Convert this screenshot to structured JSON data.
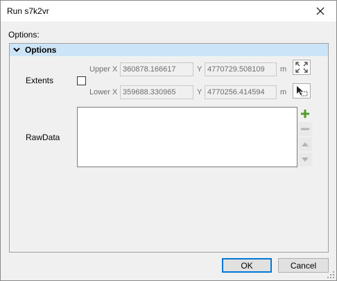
{
  "window": {
    "title": "Run s7k2vr"
  },
  "options_label": "Options:",
  "section": {
    "title": "Options"
  },
  "extents": {
    "label": "Extents",
    "checked": false,
    "upper_x_label": "Upper X",
    "upper_x_value": "360878.166617",
    "upper_y_label": "Y",
    "upper_y_value": "4770729.508109",
    "upper_unit": "m",
    "lower_x_label": "Lower X",
    "lower_x_value": "359688.330965",
    "lower_y_label": "Y",
    "lower_y_value": "4770256.414594",
    "lower_unit": "m"
  },
  "rawdata": {
    "label": "RawData",
    "items": []
  },
  "buttons": {
    "ok": "OK",
    "cancel": "Cancel"
  },
  "colors": {
    "accent": "#0078d7",
    "section_bg": "#cce4f7",
    "add_green": "#4f9a2a"
  }
}
